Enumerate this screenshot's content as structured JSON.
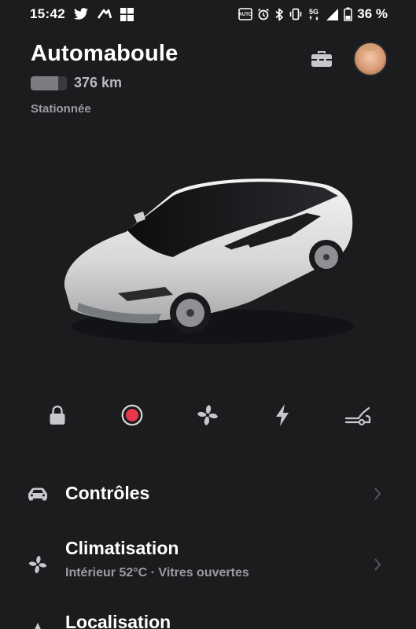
{
  "status_bar": {
    "time": "15:42",
    "battery_percent": "36 %",
    "network": "5G",
    "left_icons": [
      "twitter-icon",
      "credit-agricole-icon",
      "windows-icon"
    ],
    "right_icons": [
      "auto-brightness-icon",
      "alarm-icon",
      "bluetooth-icon",
      "vibrate-icon",
      "5g-icon",
      "signal-icon",
      "battery-icon"
    ]
  },
  "vehicle": {
    "name": "Automaboule",
    "range": "376 km",
    "battery_level": 0.75,
    "status": "Stationnée"
  },
  "header_actions": [
    "toolbox-icon",
    "profile-avatar"
  ],
  "quick_actions": [
    {
      "icon": "lock-icon"
    },
    {
      "icon": "record-icon"
    },
    {
      "icon": "fan-icon"
    },
    {
      "icon": "charge-icon"
    },
    {
      "icon": "trunk-icon"
    }
  ],
  "menu": {
    "controls": {
      "title": "Contrôles",
      "icon": "car-icon"
    },
    "climate": {
      "title": "Climatisation",
      "subtitle": "Intérieur 52°C · Vitres ouvertes",
      "icon": "fan-icon"
    },
    "location": {
      "title": "Localisation",
      "icon": "location-icon"
    }
  },
  "colors": {
    "background": "#1b1c1e",
    "record_red": "#e8374a",
    "icon_gray": "#c7c8cb",
    "muted_text": "#9a9ca0"
  }
}
